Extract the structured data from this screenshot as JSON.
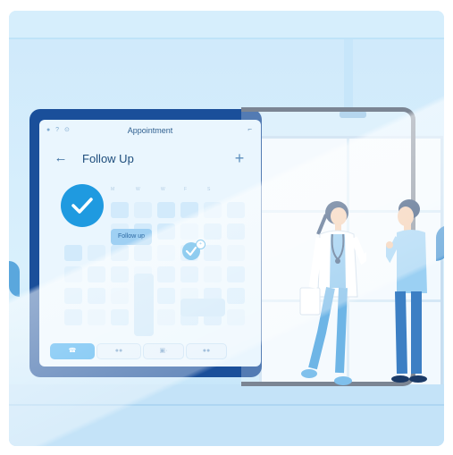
{
  "app": {
    "title": "Appointment",
    "status_icons": "● ? ⊙",
    "status_right": "⌐"
  },
  "header": {
    "back_icon": "back-arrow-icon",
    "title": "Follow Up",
    "add_icon": "plus-icon"
  },
  "calendar": {
    "weekdays": [
      "M",
      "W",
      "W",
      "F",
      "S"
    ],
    "follow_up_tag": "Follow up",
    "badge": "+"
  },
  "bottom_bar": {
    "buttons": [
      {
        "label": "☎",
        "icon": "phone-icon",
        "active": true
      },
      {
        "label": "●●",
        "icon": "chat-icon",
        "active": false
      },
      {
        "label": "▣·",
        "icon": "video-icon",
        "active": false
      },
      {
        "label": "●●",
        "icon": "people-icon",
        "active": false
      }
    ]
  },
  "colors": {
    "accent": "#1f9ae0",
    "tablet_frame": "#1a4f9a",
    "screen_bg": "#eaf6fe"
  }
}
